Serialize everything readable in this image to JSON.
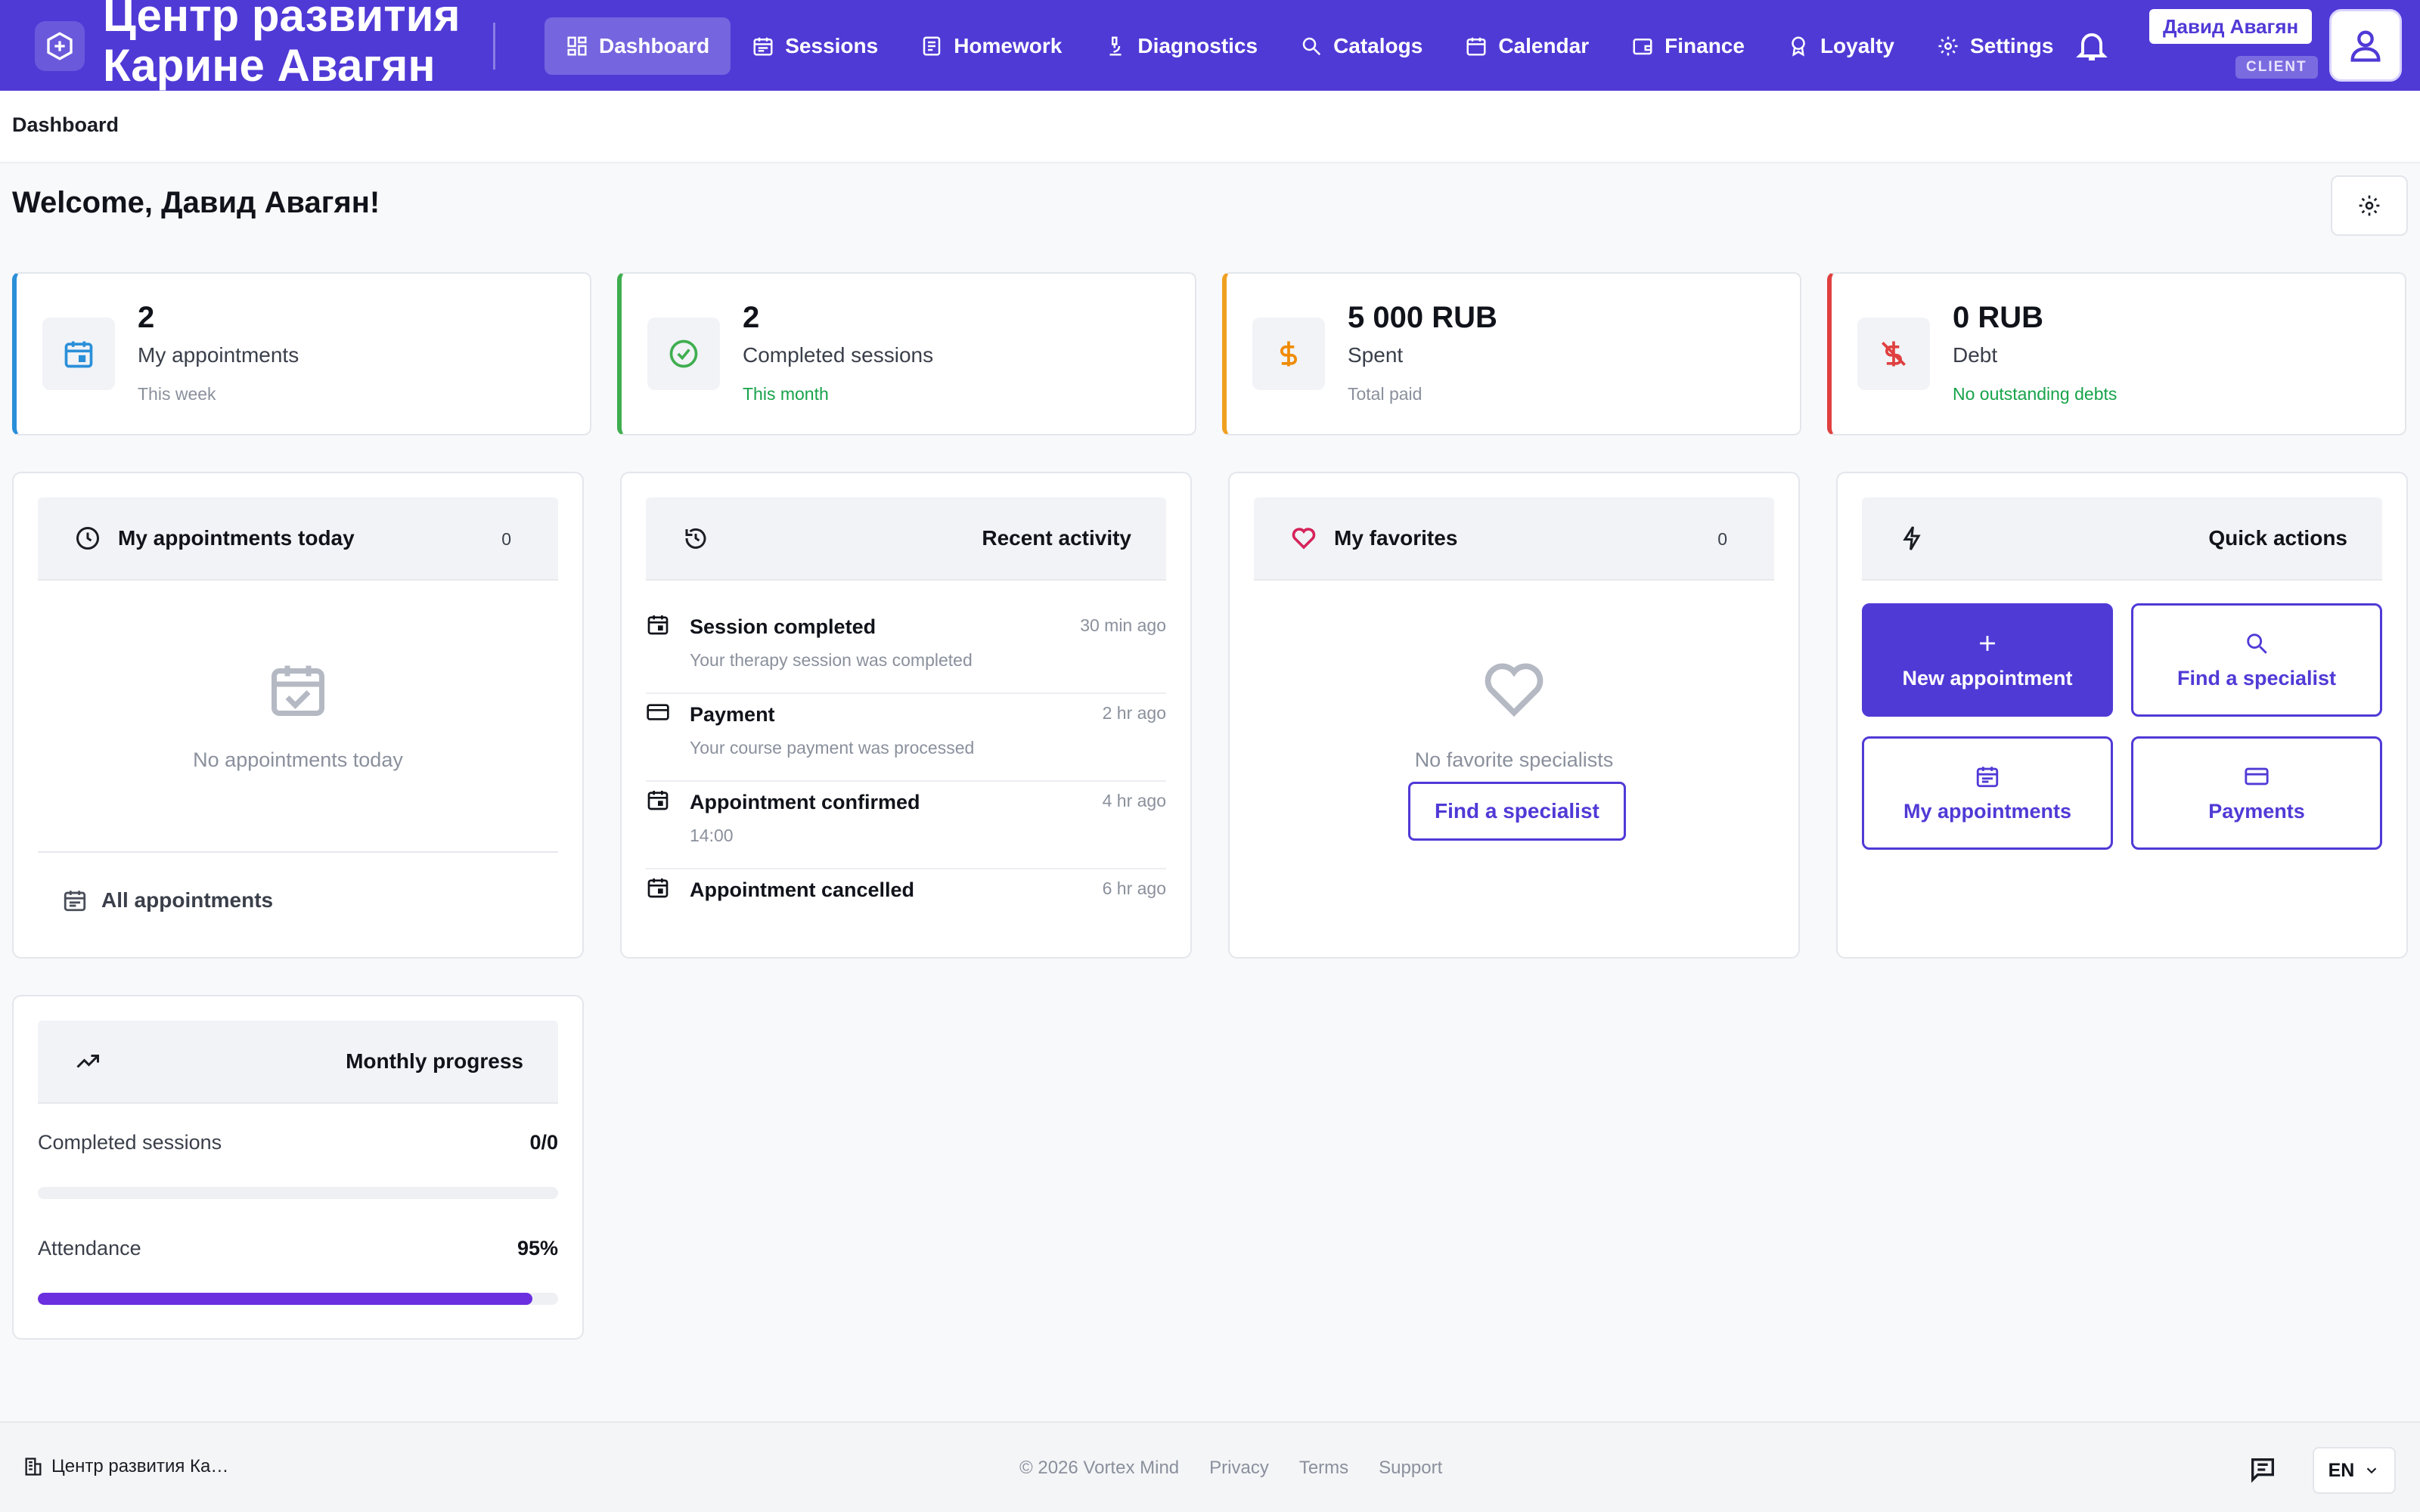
{
  "header": {
    "brand": "Центр развития\nКарине Авагян",
    "nav": [
      {
        "label": "Dashboard",
        "icon": "dashboard-icon",
        "active": true
      },
      {
        "label": "Sessions",
        "icon": "calendar-icon"
      },
      {
        "label": "Homework",
        "icon": "document-icon"
      },
      {
        "label": "Diagnostics",
        "icon": "microscope-icon"
      },
      {
        "label": "Catalogs",
        "icon": "search-icon"
      },
      {
        "label": "Calendar",
        "icon": "calendar-icon"
      },
      {
        "label": "Finance",
        "icon": "wallet-icon"
      },
      {
        "label": "Loyalty",
        "icon": "medal-icon"
      },
      {
        "label": "Settings",
        "icon": "gear-icon"
      }
    ],
    "user_name": "Давид Авагян",
    "role": "CLIENT"
  },
  "breadcrumb": "Dashboard",
  "welcome": "Welcome, Давид Авагян!",
  "stats": [
    {
      "value": "2",
      "label": "My appointments",
      "sub": "This week",
      "color": "#2a8fd9",
      "icon": "calendar-icon"
    },
    {
      "value": "2",
      "label": "Completed sessions",
      "sub": "This month",
      "color": "#3fae4f",
      "icon": "check-circle-icon"
    },
    {
      "value": "5 000 RUB",
      "label": "Spent",
      "sub": "Total paid",
      "color": "#f0a020",
      "icon": "dollar-icon"
    },
    {
      "value": "0 RUB",
      "label": "Debt",
      "sub": "No outstanding debts",
      "color": "#e04040",
      "icon": "money-off-icon"
    }
  ],
  "today": {
    "title": "My appointments today",
    "count": "0",
    "empty": "No appointments today",
    "link": "All appointments"
  },
  "activity": {
    "title": "Recent activity",
    "items": [
      {
        "title": "Session completed",
        "desc": "Your therapy session was completed",
        "time": "30 min ago",
        "icon": "calendar-icon"
      },
      {
        "title": "Payment",
        "desc": "Your course payment was processed",
        "time": "2 hr ago",
        "icon": "card-icon"
      },
      {
        "title": "Appointment confirmed",
        "desc": "14:00",
        "time": "4 hr ago",
        "icon": "calendar-icon"
      },
      {
        "title": "Appointment cancelled",
        "desc": "",
        "time": "6 hr ago",
        "icon": "calendar-icon"
      }
    ]
  },
  "favorites": {
    "title": "My favorites",
    "count": "0",
    "empty": "No favorite specialists",
    "button": "Find a specialist"
  },
  "quick_actions": {
    "title": "Quick actions",
    "buttons": [
      {
        "label": "New appointment",
        "icon": "plus-icon"
      },
      {
        "label": "Find a specialist",
        "icon": "search-icon"
      },
      {
        "label": "My appointments",
        "icon": "calendar-icon"
      },
      {
        "label": "Payments",
        "icon": "card-icon"
      }
    ]
  },
  "progress": {
    "title": "Monthly progress",
    "rows": [
      {
        "label": "Completed sessions",
        "value": "0/0",
        "fraction": 0
      },
      {
        "label": "Attendance",
        "value": "95%",
        "fraction": 0.95
      }
    ]
  },
  "footer": {
    "org": "Центр развития Ка…",
    "links": [
      "© 2026 Vortex Mind",
      "Privacy",
      "Terms",
      "Support"
    ],
    "lang": "EN"
  },
  "colors": {
    "accent": "#4f3ad6",
    "progress": "#6b2fe0"
  }
}
